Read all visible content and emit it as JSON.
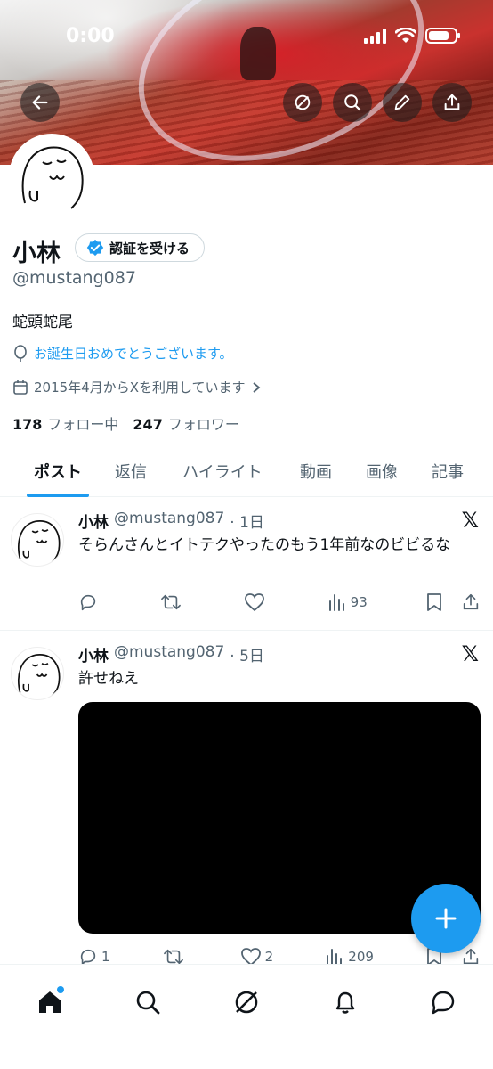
{
  "status_bar": {
    "time": "0:00"
  },
  "profile": {
    "name": "小林",
    "verify_label": "認証を受ける",
    "handle": "@mustang087",
    "bio": "蛇頭蛇尾",
    "birthday": "お誕生日おめでとうございます。",
    "joined": "2015年4月からXを利用しています",
    "following_count": "178",
    "following_label": "フォロー中",
    "followers_count": "247",
    "followers_label": "フォロワー"
  },
  "tabs": [
    {
      "label": "ポスト",
      "active": true
    },
    {
      "label": "返信"
    },
    {
      "label": "ハイライト"
    },
    {
      "label": "動画"
    },
    {
      "label": "画像"
    },
    {
      "label": "記事"
    }
  ],
  "posts": [
    {
      "name": "小林",
      "handle": "@mustang087",
      "time": "· 1日",
      "text": "そらんさんとイトテクやったのもう1年前なのビビるな",
      "replies": "",
      "reposts": "",
      "likes": "",
      "views": "93"
    },
    {
      "name": "小林",
      "handle": "@mustang087",
      "time": "· 5日",
      "text": "許せねえ",
      "replies": "1",
      "reposts": "",
      "likes": "2",
      "views": "209"
    }
  ],
  "colors": {
    "accent": "#1d9bf0",
    "text": "#0f1419",
    "muted": "#536471"
  },
  "icons": [
    "back-arrow-icon",
    "grok-icon",
    "search-icon",
    "edit-icon",
    "share-icon",
    "verified-badge-icon",
    "balloon-icon",
    "calendar-icon",
    "reply-icon",
    "repost-icon",
    "like-icon",
    "views-icon",
    "bookmark-icon",
    "x-logo-icon",
    "plus-icon",
    "home-icon",
    "bell-icon",
    "messages-icon"
  ]
}
